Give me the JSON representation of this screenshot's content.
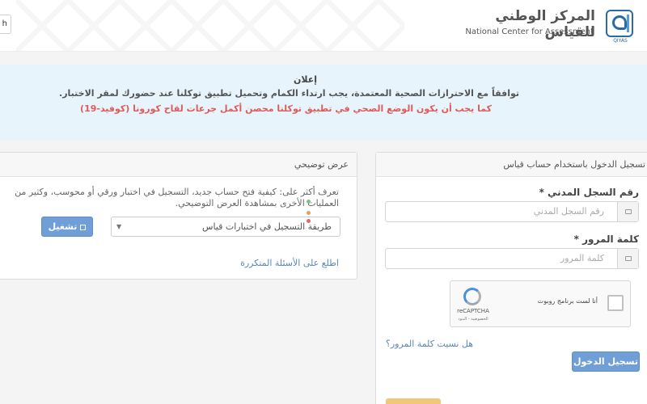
{
  "header": {
    "org_name_ar": "المركز الوطني للقياس",
    "org_name_en": "National Center for Assessment",
    "logo_caption": "QIYAS",
    "lang_button": "h"
  },
  "announcement": {
    "title": "إعلان",
    "line1": "توافقاً مع الاحترازات الصحية المعتمدة، يجب ارتداء الكمام وتحميل تطبيق توكلنا عند حضورك لمقر الاختبار.",
    "line2": "كما يجب أن يكون الوضع الصحي في تطبيق توكلنا محصن أكمل جرعات لقاح كورونا (كوفيد-19)",
    "line2_color": "#e05a5a"
  },
  "demo": {
    "title": "عرض توضيحي",
    "description": "تعرف أكثر على: كيفية فتح حساب جديد، التسجيل في اختبار ورقي أو محوسب، وكثير من العمليات الأخرى بمشاهدة العرض التوضيحي.",
    "select_value": "طريقة التسجيل في اختبارات قياس",
    "play_label": "تشغيل",
    "faq_link": "اطلع على الأسئلة المتكررة"
  },
  "login": {
    "title": "تسجيل الدخول باستخدام حساب قياس",
    "id_label": "رقم السجل المدني",
    "id_placeholder": "رقم السجل المدني",
    "password_label": "كلمة المرور",
    "password_placeholder": "كلمة المرور",
    "required_mark": "*",
    "captcha_label": "أنا لست برنامج روبوت",
    "captcha_brand": "reCAPTCHA",
    "captcha_terms": "الخصوصية - البنود",
    "forgot_link": "هل نسيت كلمة المرور؟",
    "submit_label": "تسجيل الدخول"
  },
  "colors": {
    "accent": "#6f9fd6",
    "link": "#5a86b4",
    "announce_bg": "#e7f4fb"
  }
}
